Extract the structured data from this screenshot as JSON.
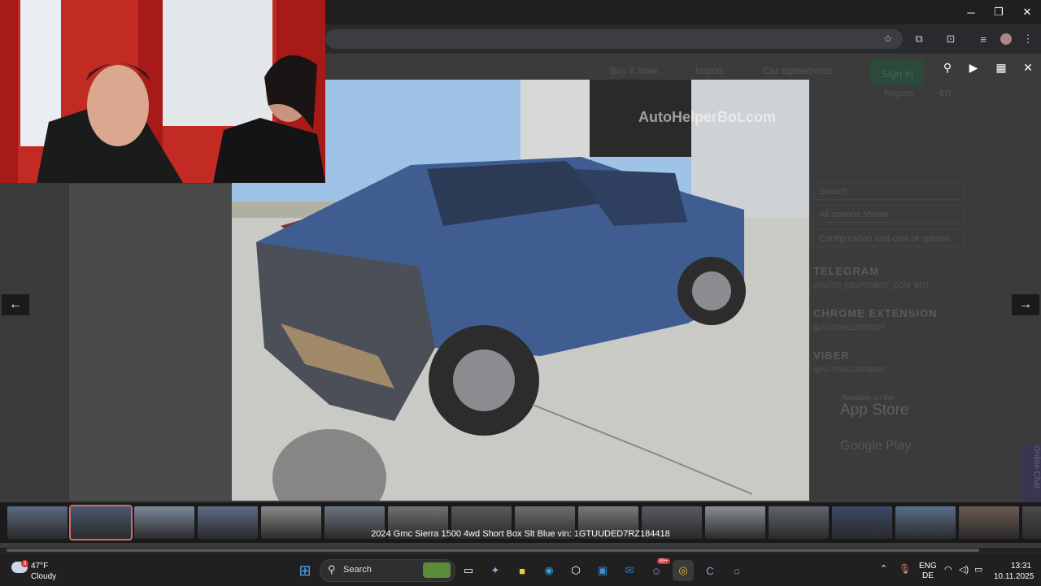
{
  "browser": {
    "window_controls": {
      "minimize": "─",
      "restore": "❐",
      "close": "✕"
    },
    "toolbar_icons": [
      "star-icon",
      "extensions-icon",
      "tab-search-icon",
      "media-icon",
      "profile-avatar",
      "menu-icon"
    ]
  },
  "background_page": {
    "buy_it_now": "Buy It Now",
    "import": "Import",
    "car_agreements": "Car agreements",
    "sign_in": "Sign in",
    "register": "Register",
    "lang": "en",
    "options": [
      "Search",
      "All options shown",
      "Configuration and cost of options"
    ],
    "telegram": "TELEGRAM",
    "telegram_handle": "@AUTO_HELPERBOT_COM_BOT",
    "chrome_extension": "CHROME EXTENSION",
    "chrome_handle": "@AUTOHELPERBOT",
    "viber": "VIBER",
    "viber_handle": "@AUTOHELPERBOT",
    "appstore_small": "Available on the",
    "appstore": "App Store",
    "googleplay": "Google Play",
    "side_tab": "Online Chat"
  },
  "viewer": {
    "watermark": "AutoHelperBot.com",
    "caption": "2024 Gmc Sierra 1500 4wd Short Box Slt Blue vin: 1GTUUDED7RZ184418",
    "prev": "←",
    "next": "→",
    "thumb_count": 17,
    "selected_thumb": 2,
    "tools": [
      "zoom-icon",
      "play-icon",
      "grid-icon",
      "close-icon"
    ]
  },
  "taskbar": {
    "weather": {
      "temp": "47°F",
      "cond": "Cloudy",
      "badge": "3"
    },
    "search_placeholder": "Search",
    "lang_top": "ENG",
    "lang_bottom": "DE",
    "time": "13:31",
    "date": "10.11.2025",
    "discord_badge": "99+"
  },
  "colors": {
    "accent_green": "#2e7d4f",
    "selected_thumb": "#d46a6a"
  }
}
